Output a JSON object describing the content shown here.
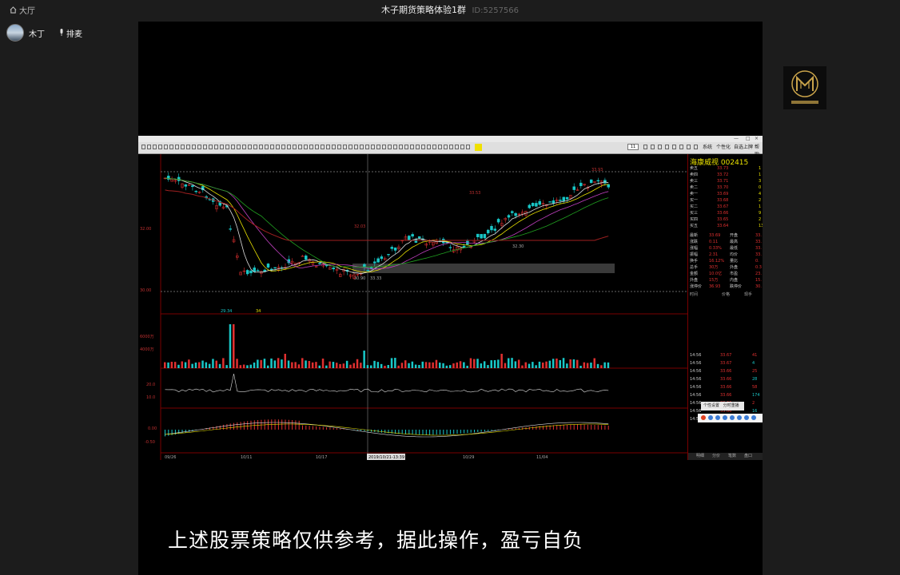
{
  "header": {
    "home_label": "大厅",
    "room_title": "木子期货策略体验1群",
    "room_id": "ID:5257566"
  },
  "host": {
    "name": "木丁",
    "rank_label": "排麦"
  },
  "logo": {
    "text": "木子金融"
  },
  "terminal": {
    "stock_name": "海康威视",
    "stock_code": "002415",
    "price_levels": [
      "32.00",
      "30.00"
    ],
    "volume_levels": [
      "6000万",
      "4000万",
      "20.0",
      "10.0",
      "0.00",
      "-0.50"
    ],
    "date_ticks": [
      "09/26",
      "10/11",
      "10/17",
      "2019/10/21-13:39",
      "10/29",
      "11/04"
    ],
    "annotations": [
      "33.93",
      "33.53",
      "32.03",
      "30.90",
      "33.33",
      "32.30",
      "29.34",
      "34"
    ],
    "input_value": "11",
    "right_toolbar": [
      "系统",
      "个性化",
      "自选上牌",
      "帮助"
    ],
    "order_book": [
      {
        "label": "卖五",
        "price": "33.73",
        "vol": "1"
      },
      {
        "label": "卖四",
        "price": "33.72",
        "vol": "1"
      },
      {
        "label": "卖三",
        "price": "33.71",
        "vol": "3"
      },
      {
        "label": "卖二",
        "price": "33.70",
        "vol": "0"
      },
      {
        "label": "卖一",
        "price": "33.69",
        "vol": "4"
      },
      {
        "label": "买一",
        "price": "33.68",
        "vol": "2"
      },
      {
        "label": "买二",
        "price": "33.67",
        "vol": "1"
      },
      {
        "label": "买三",
        "price": "33.66",
        "vol": "9"
      },
      {
        "label": "买四",
        "price": "33.65",
        "vol": "2"
      },
      {
        "label": "买五",
        "price": "33.64",
        "vol": "13"
      }
    ],
    "stats": [
      {
        "a": "最新",
        "b": "33.69",
        "c": "开盘",
        "d": "33."
      },
      {
        "a": "涨跌",
        "b": "0.11",
        "c": "最高",
        "d": "33."
      },
      {
        "a": "涨幅",
        "b": "0.33%",
        "c": "最低",
        "d": "33."
      },
      {
        "a": "振幅",
        "b": "2.31",
        "c": "均价",
        "d": "33."
      },
      {
        "a": "换手",
        "b": "16.12%",
        "c": "量比",
        "d": "0."
      },
      {
        "a": "总手",
        "b": "30万",
        "c": "外盘",
        "d": "0.3"
      },
      {
        "a": "金额",
        "b": "10.0亿",
        "c": "市盈",
        "d": "23."
      },
      {
        "a": "外盘",
        "b": "15万",
        "c": "内盘",
        "d": "15."
      },
      {
        "a": "涨停价",
        "b": "36.93",
        "c": "跌停价",
        "d": "30."
      }
    ],
    "trades_header": [
      "时间",
      "价格",
      "现手"
    ],
    "trades": [
      {
        "t": "14:56",
        "p": "33.67",
        "v": "41"
      },
      {
        "t": "14:56",
        "p": "33.67",
        "v": "4"
      },
      {
        "t": "14:56",
        "p": "33.66",
        "v": "25"
      },
      {
        "t": "14:56",
        "p": "33.66",
        "v": "28"
      },
      {
        "t": "14:56",
        "p": "33.66",
        "v": "58"
      },
      {
        "t": "14:56",
        "p": "33.66",
        "v": "174"
      },
      {
        "t": "14:56",
        "p": "33.66",
        "v": "2"
      },
      {
        "t": "14:56",
        "p": "33.66",
        "v": "16"
      },
      {
        "t": "14:56",
        "p": "33.68",
        "v": "1527"
      }
    ],
    "bottom_tabs": [
      "明细",
      "分价",
      "笔数",
      "盘口"
    ],
    "popup_items": [
      "个性设置",
      "分时重播"
    ]
  },
  "subtitle": "上述股票策略仅供参考，据此操作，盈亏自负",
  "colors": {
    "up": "#e03030",
    "down": "#19c8c8",
    "ma_yellow": "#e8e000",
    "ma_white": "#dddddd"
  }
}
